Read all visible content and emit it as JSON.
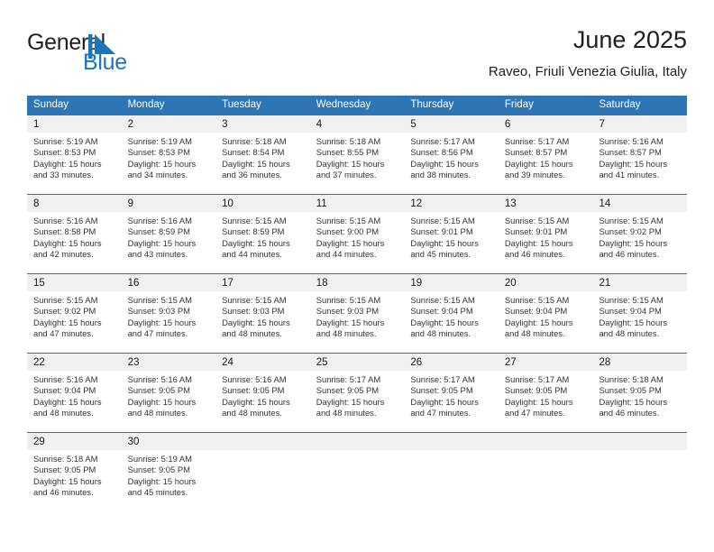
{
  "brand": {
    "name_part1": "General",
    "name_part2": "Blue",
    "accent_color": "#1b75bc"
  },
  "header": {
    "title": "June 2025",
    "location": "Raveo, Friuli Venezia Giulia, Italy"
  },
  "calendar": {
    "header_color": "#2e75b6",
    "daynum_bg": "#f0f0f0",
    "weekday_names": [
      "Sunday",
      "Monday",
      "Tuesday",
      "Wednesday",
      "Thursday",
      "Friday",
      "Saturday"
    ],
    "weeks": [
      [
        {
          "day": "1",
          "sunrise": "Sunrise: 5:19 AM",
          "sunset": "Sunset: 8:53 PM",
          "daylight1": "Daylight: 15 hours",
          "daylight2": "and 33 minutes."
        },
        {
          "day": "2",
          "sunrise": "Sunrise: 5:19 AM",
          "sunset": "Sunset: 8:53 PM",
          "daylight1": "Daylight: 15 hours",
          "daylight2": "and 34 minutes."
        },
        {
          "day": "3",
          "sunrise": "Sunrise: 5:18 AM",
          "sunset": "Sunset: 8:54 PM",
          "daylight1": "Daylight: 15 hours",
          "daylight2": "and 36 minutes."
        },
        {
          "day": "4",
          "sunrise": "Sunrise: 5:18 AM",
          "sunset": "Sunset: 8:55 PM",
          "daylight1": "Daylight: 15 hours",
          "daylight2": "and 37 minutes."
        },
        {
          "day": "5",
          "sunrise": "Sunrise: 5:17 AM",
          "sunset": "Sunset: 8:56 PM",
          "daylight1": "Daylight: 15 hours",
          "daylight2": "and 38 minutes."
        },
        {
          "day": "6",
          "sunrise": "Sunrise: 5:17 AM",
          "sunset": "Sunset: 8:57 PM",
          "daylight1": "Daylight: 15 hours",
          "daylight2": "and 39 minutes."
        },
        {
          "day": "7",
          "sunrise": "Sunrise: 5:16 AM",
          "sunset": "Sunset: 8:57 PM",
          "daylight1": "Daylight: 15 hours",
          "daylight2": "and 41 minutes."
        }
      ],
      [
        {
          "day": "8",
          "sunrise": "Sunrise: 5:16 AM",
          "sunset": "Sunset: 8:58 PM",
          "daylight1": "Daylight: 15 hours",
          "daylight2": "and 42 minutes."
        },
        {
          "day": "9",
          "sunrise": "Sunrise: 5:16 AM",
          "sunset": "Sunset: 8:59 PM",
          "daylight1": "Daylight: 15 hours",
          "daylight2": "and 43 minutes."
        },
        {
          "day": "10",
          "sunrise": "Sunrise: 5:15 AM",
          "sunset": "Sunset: 8:59 PM",
          "daylight1": "Daylight: 15 hours",
          "daylight2": "and 44 minutes."
        },
        {
          "day": "11",
          "sunrise": "Sunrise: 5:15 AM",
          "sunset": "Sunset: 9:00 PM",
          "daylight1": "Daylight: 15 hours",
          "daylight2": "and 44 minutes."
        },
        {
          "day": "12",
          "sunrise": "Sunrise: 5:15 AM",
          "sunset": "Sunset: 9:01 PM",
          "daylight1": "Daylight: 15 hours",
          "daylight2": "and 45 minutes."
        },
        {
          "day": "13",
          "sunrise": "Sunrise: 5:15 AM",
          "sunset": "Sunset: 9:01 PM",
          "daylight1": "Daylight: 15 hours",
          "daylight2": "and 46 minutes."
        },
        {
          "day": "14",
          "sunrise": "Sunrise: 5:15 AM",
          "sunset": "Sunset: 9:02 PM",
          "daylight1": "Daylight: 15 hours",
          "daylight2": "and 46 minutes."
        }
      ],
      [
        {
          "day": "15",
          "sunrise": "Sunrise: 5:15 AM",
          "sunset": "Sunset: 9:02 PM",
          "daylight1": "Daylight: 15 hours",
          "daylight2": "and 47 minutes."
        },
        {
          "day": "16",
          "sunrise": "Sunrise: 5:15 AM",
          "sunset": "Sunset: 9:03 PM",
          "daylight1": "Daylight: 15 hours",
          "daylight2": "and 47 minutes."
        },
        {
          "day": "17",
          "sunrise": "Sunrise: 5:15 AM",
          "sunset": "Sunset: 9:03 PM",
          "daylight1": "Daylight: 15 hours",
          "daylight2": "and 48 minutes."
        },
        {
          "day": "18",
          "sunrise": "Sunrise: 5:15 AM",
          "sunset": "Sunset: 9:03 PM",
          "daylight1": "Daylight: 15 hours",
          "daylight2": "and 48 minutes."
        },
        {
          "day": "19",
          "sunrise": "Sunrise: 5:15 AM",
          "sunset": "Sunset: 9:04 PM",
          "daylight1": "Daylight: 15 hours",
          "daylight2": "and 48 minutes."
        },
        {
          "day": "20",
          "sunrise": "Sunrise: 5:15 AM",
          "sunset": "Sunset: 9:04 PM",
          "daylight1": "Daylight: 15 hours",
          "daylight2": "and 48 minutes."
        },
        {
          "day": "21",
          "sunrise": "Sunrise: 5:15 AM",
          "sunset": "Sunset: 9:04 PM",
          "daylight1": "Daylight: 15 hours",
          "daylight2": "and 48 minutes."
        }
      ],
      [
        {
          "day": "22",
          "sunrise": "Sunrise: 5:16 AM",
          "sunset": "Sunset: 9:04 PM",
          "daylight1": "Daylight: 15 hours",
          "daylight2": "and 48 minutes."
        },
        {
          "day": "23",
          "sunrise": "Sunrise: 5:16 AM",
          "sunset": "Sunset: 9:05 PM",
          "daylight1": "Daylight: 15 hours",
          "daylight2": "and 48 minutes."
        },
        {
          "day": "24",
          "sunrise": "Sunrise: 5:16 AM",
          "sunset": "Sunset: 9:05 PM",
          "daylight1": "Daylight: 15 hours",
          "daylight2": "and 48 minutes."
        },
        {
          "day": "25",
          "sunrise": "Sunrise: 5:17 AM",
          "sunset": "Sunset: 9:05 PM",
          "daylight1": "Daylight: 15 hours",
          "daylight2": "and 48 minutes."
        },
        {
          "day": "26",
          "sunrise": "Sunrise: 5:17 AM",
          "sunset": "Sunset: 9:05 PM",
          "daylight1": "Daylight: 15 hours",
          "daylight2": "and 47 minutes."
        },
        {
          "day": "27",
          "sunrise": "Sunrise: 5:17 AM",
          "sunset": "Sunset: 9:05 PM",
          "daylight1": "Daylight: 15 hours",
          "daylight2": "and 47 minutes."
        },
        {
          "day": "28",
          "sunrise": "Sunrise: 5:18 AM",
          "sunset": "Sunset: 9:05 PM",
          "daylight1": "Daylight: 15 hours",
          "daylight2": "and 46 minutes."
        }
      ],
      [
        {
          "day": "29",
          "sunrise": "Sunrise: 5:18 AM",
          "sunset": "Sunset: 9:05 PM",
          "daylight1": "Daylight: 15 hours",
          "daylight2": "and 46 minutes."
        },
        {
          "day": "30",
          "sunrise": "Sunrise: 5:19 AM",
          "sunset": "Sunset: 9:05 PM",
          "daylight1": "Daylight: 15 hours",
          "daylight2": "and 45 minutes."
        },
        {
          "day": "",
          "sunrise": "",
          "sunset": "",
          "daylight1": "",
          "daylight2": ""
        },
        {
          "day": "",
          "sunrise": "",
          "sunset": "",
          "daylight1": "",
          "daylight2": ""
        },
        {
          "day": "",
          "sunrise": "",
          "sunset": "",
          "daylight1": "",
          "daylight2": ""
        },
        {
          "day": "",
          "sunrise": "",
          "sunset": "",
          "daylight1": "",
          "daylight2": ""
        },
        {
          "day": "",
          "sunrise": "",
          "sunset": "",
          "daylight1": "",
          "daylight2": ""
        }
      ]
    ]
  }
}
